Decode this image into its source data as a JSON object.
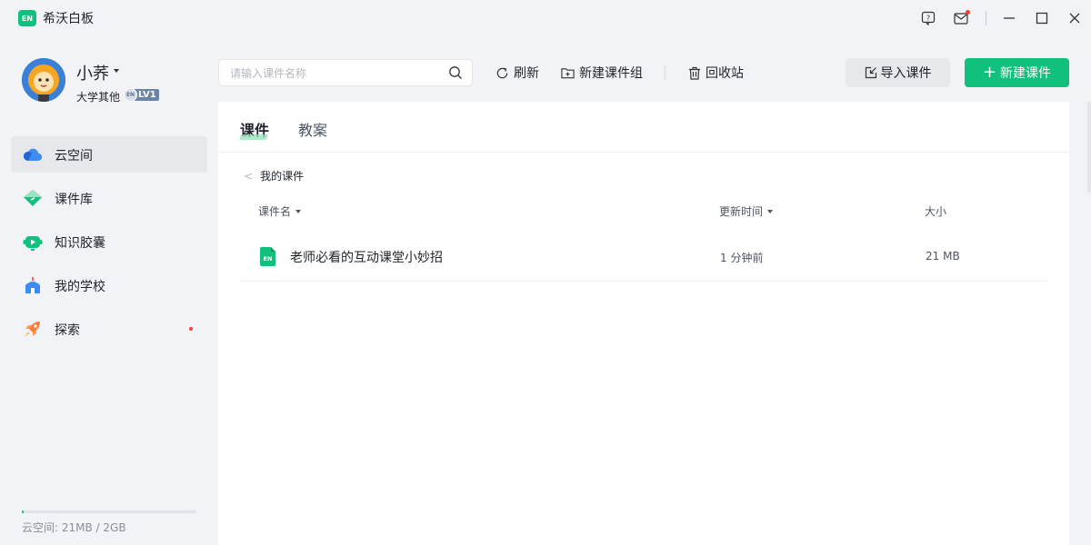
{
  "app": {
    "title": "希沃白板",
    "logo_text": "EN"
  },
  "titlebar": {
    "icons": [
      "help-icon",
      "mail-icon",
      "minimize-icon",
      "maximize-icon",
      "close-icon"
    ]
  },
  "user": {
    "name": "小荞",
    "org": "大学其他",
    "level_icon_text": "EN",
    "level": "LV1"
  },
  "sidebar": {
    "items": [
      {
        "label": "云空间",
        "icon": "cloud-icon",
        "active": true
      },
      {
        "label": "课件库",
        "icon": "library-icon",
        "active": false
      },
      {
        "label": "知识胶囊",
        "icon": "capsule-icon",
        "active": false
      },
      {
        "label": "我的学校",
        "icon": "school-icon",
        "active": false
      },
      {
        "label": "探索",
        "icon": "rocket-icon",
        "active": false,
        "notification": true
      }
    ],
    "storage": {
      "label": "云空间:  21MB / 2GB",
      "used_fraction": 0.0103
    }
  },
  "toolbar": {
    "search_placeholder": "请输入课件名称",
    "refresh_label": "刷新",
    "new_group_label": "新建课件组",
    "recycle_label": "回收站",
    "import_label": "导入课件",
    "new_label": "新建课件"
  },
  "main": {
    "tabs": [
      {
        "label": "课件",
        "active": true
      },
      {
        "label": "教案",
        "active": false
      }
    ],
    "breadcrumb": "我的课件",
    "columns": [
      "课件名",
      "更新时间",
      "大小"
    ],
    "files": [
      {
        "name": "老师必看的互动课堂小妙招",
        "updated": "1 分钟前",
        "size": "21 MB",
        "icon_text": "EN"
      }
    ]
  },
  "colors": {
    "accent": "#12c07e",
    "badge": "#6c84a8",
    "notify": "#f5413a"
  }
}
